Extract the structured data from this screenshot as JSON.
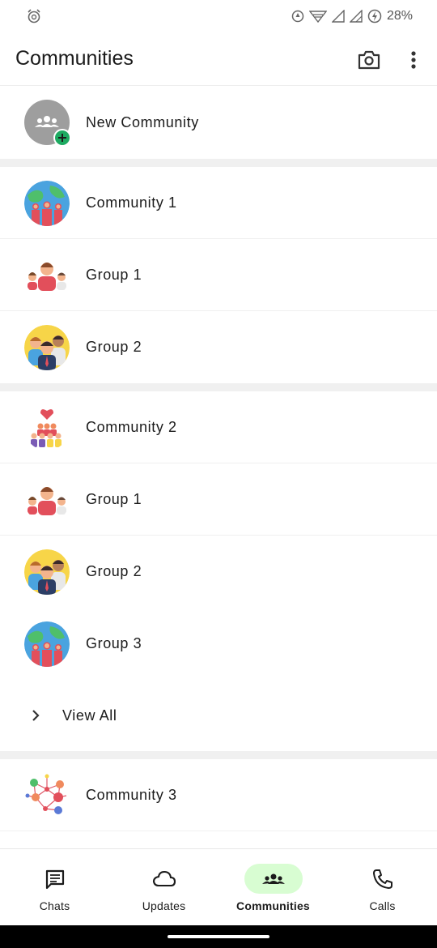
{
  "status_bar": {
    "battery": "28%",
    "icons": [
      "alarm-icon",
      "data-saver-icon",
      "wifi-icon",
      "signal-icon",
      "signal-icon",
      "battery-charging-icon"
    ]
  },
  "header": {
    "title": "Communities",
    "actions": [
      "camera-icon",
      "more-vert-icon"
    ]
  },
  "new_community": {
    "label": "New Community",
    "icon": "community-add-icon"
  },
  "communities": [
    {
      "name": "Community 1",
      "avatar": "globe-people-avatar",
      "groups": [
        {
          "name": "Group 1",
          "avatar": "three-people-avatar"
        },
        {
          "name": "Group 2",
          "avatar": "team-avatar"
        }
      ]
    },
    {
      "name": "Community 2",
      "avatar": "heart-crowd-avatar",
      "groups": [
        {
          "name": "Group 1",
          "avatar": "three-people-avatar"
        },
        {
          "name": "Group 2",
          "avatar": "team-avatar"
        },
        {
          "name": "Group 3",
          "avatar": "globe-people-avatar"
        }
      ],
      "view_all": "View All"
    },
    {
      "name": "Community 3",
      "avatar": "network-avatar",
      "groups": []
    }
  ],
  "bottom_nav": {
    "items": [
      {
        "label": "Chats",
        "icon": "chat-icon",
        "active": false
      },
      {
        "label": "Updates",
        "icon": "cloud-icon",
        "active": false
      },
      {
        "label": "Communities",
        "icon": "community-icon",
        "active": true
      },
      {
        "label": "Calls",
        "icon": "phone-icon",
        "active": false
      }
    ]
  },
  "colors": {
    "accent": "#1daa61",
    "active_pill": "#d8fdd2",
    "divider": "#f0f0f0",
    "avatar_placeholder": "#9e9e9e"
  }
}
